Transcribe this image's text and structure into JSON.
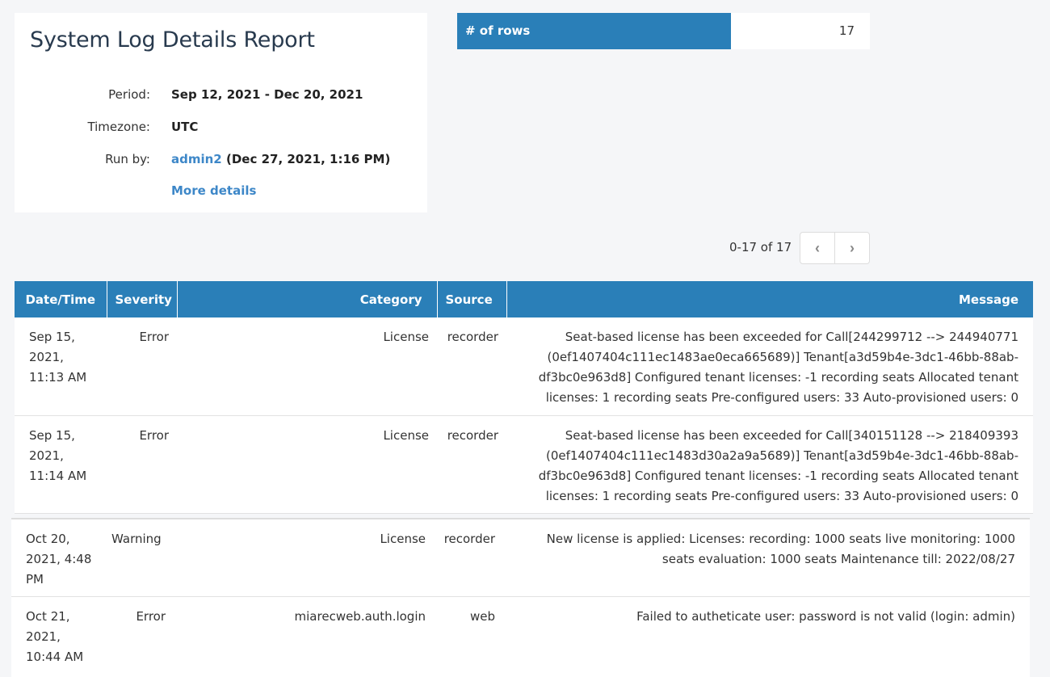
{
  "report": {
    "title": "System Log Details Report",
    "period_label": "Period:",
    "period_value": "Sep 12, 2021 - Dec 20, 2021",
    "timezone_label": "Timezone:",
    "timezone_value": "UTC",
    "run_by_label": "Run by:",
    "run_by_user": "admin2",
    "run_by_time": " (Dec 27, 2021, 1:16 PM)",
    "more_details": "More details"
  },
  "stats": {
    "rows_label": "# of rows",
    "rows_value": "17"
  },
  "pagination": {
    "range_text": "0-17 of 17",
    "prev_icon": "chevron-left-icon",
    "next_icon": "chevron-right-icon",
    "prev_glyph": "‹",
    "next_glyph": "›"
  },
  "table": {
    "columns": [
      "Date/Time",
      "Severity",
      "Category",
      "Source",
      "Message"
    ],
    "rows": [
      {
        "datetime": "Sep 15, 2021, 11:13 AM",
        "severity": "Error",
        "category": "License",
        "source": "recorder",
        "message": "Seat-based license has been exceeded for Call[244299712 --> 244940771 (0ef1407404c111ec1483ae0eca665689)] Tenant[a3d59b4e-3dc1-46bb-88ab-df3bc0e963d8] Configured tenant licenses: -1 recording seats Allocated tenant licenses: 1 recording seats Pre-configured users: 33 Auto-provisioned users: 0"
      },
      {
        "datetime": "Sep 15, 2021, 11:14 AM",
        "severity": "Error",
        "category": "License",
        "source": "recorder",
        "message": "Seat-based license has been exceeded for Call[340151128 --> 218409393 (0ef1407404c111ec1483d30a2a9a5689)] Tenant[a3d59b4e-3dc1-46bb-88ab-df3bc0e963d8] Configured tenant licenses: -1 recording seats Allocated tenant licenses: 1 recording seats Pre-configured users: 33 Auto-provisioned users: 0"
      },
      {
        "datetime": "Oct 20, 2021, 4:48 PM",
        "severity": "Warning",
        "category": "License",
        "source": "recorder",
        "message": "New license is applied: Licenses: recording: 1000 seats live monitoring: 1000 seats evaluation: 1000 seats Maintenance till: 2022/08/27"
      },
      {
        "datetime": "Oct 21, 2021, 10:44 AM",
        "severity": "Error",
        "category": "miarecweb.auth.login",
        "source": "web",
        "message": "Failed to autheticate user: password is not valid (login: admin)"
      }
    ]
  }
}
